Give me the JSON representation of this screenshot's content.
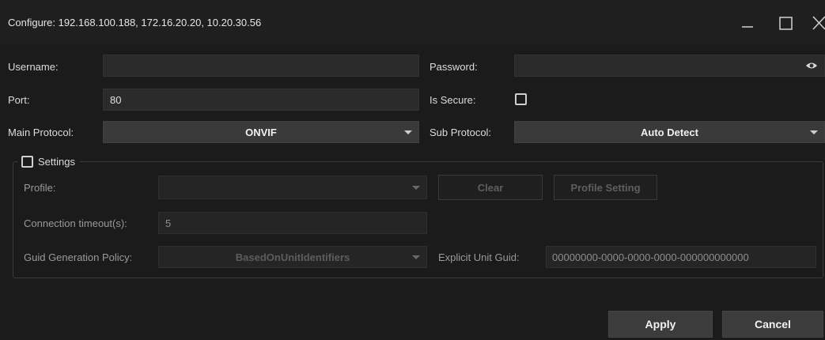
{
  "window": {
    "title": "Configure: 192.168.100.188, 172.16.20.20, 10.20.30.56",
    "minimize_icon": "minimize-icon",
    "maximize_icon": "maximize-icon",
    "close_icon": "close-icon"
  },
  "form": {
    "username_label": "Username:",
    "username_value": "",
    "password_label": "Password:",
    "password_value": "",
    "port_label": "Port:",
    "port_value": "80",
    "is_secure_label": "Is Secure:",
    "is_secure_checked": false,
    "main_protocol_label": "Main Protocol:",
    "main_protocol_value": "ONVIF",
    "sub_protocol_label": "Sub Protocol:",
    "sub_protocol_value": "Auto Detect"
  },
  "settings": {
    "label": "Settings",
    "checked": false,
    "profile_label": "Profile:",
    "profile_value": "",
    "clear_label": "Clear",
    "profile_setting_label": "Profile Setting",
    "timeout_label": "Connection timeout(s):",
    "timeout_value": "5",
    "guid_policy_label": "Guid Generation Policy:",
    "guid_policy_value": "BasedOnUnitIdentifiers",
    "explicit_guid_label": "Explicit Unit Guid:",
    "explicit_guid_value": "00000000-0000-0000-0000-000000000000"
  },
  "actions": {
    "apply_label": "Apply",
    "cancel_label": "Cancel"
  },
  "colors": {
    "background": "#1b1b1b",
    "field": "#2b2b2b",
    "select": "#3a3a3a",
    "button": "#3c3c3c"
  }
}
